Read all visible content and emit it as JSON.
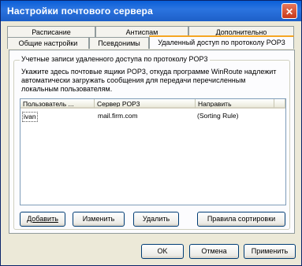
{
  "window": {
    "title": "Настройки почтового сервера"
  },
  "tabs_row1": [
    {
      "label": "Расписание"
    },
    {
      "label": "Антиспам"
    },
    {
      "label": "Дополнительно"
    }
  ],
  "tabs_row2": [
    {
      "label": "Общие настройки"
    },
    {
      "label": "Псевдонимы"
    },
    {
      "label": "Удаленный доступ по протоколу POP3"
    }
  ],
  "group": {
    "title": "Учетные записи удаленного доступа по протоколу POP3",
    "description": "Укажите здесь почтовые ящики POP3, откуда программе WinRoute надлежит автоматически загружать сообщения для передачи перечисленным локальным пользователям."
  },
  "list": {
    "columns": [
      "Пользователь ...",
      "Сервер POP3",
      "Направить"
    ],
    "rows": [
      {
        "user": "ivan",
        "server": "mail.firm.com",
        "target": "(Sorting Rule)"
      }
    ]
  },
  "buttons": {
    "add": "Добавить",
    "edit": "Изменить",
    "delete": "Удалить",
    "sort_rules": "Правила сортировки",
    "ok": "OK",
    "cancel": "Отмена",
    "apply": "Применить"
  }
}
